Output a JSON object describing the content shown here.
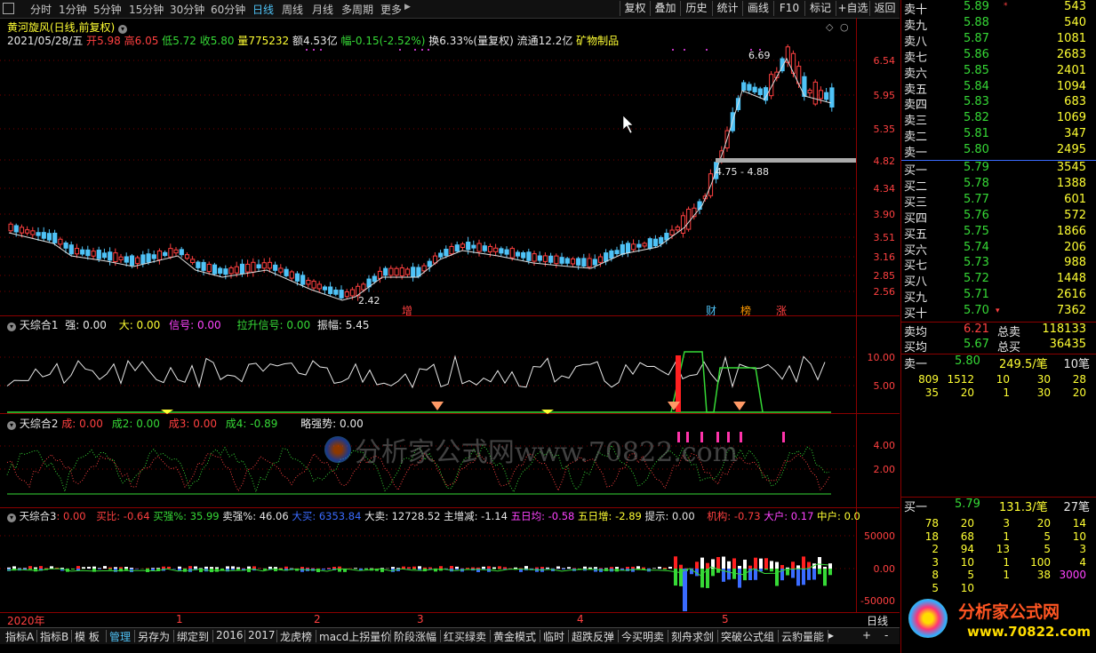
{
  "toolbar": {
    "timeframes": [
      "分时",
      "1分钟",
      "5分钟",
      "15分钟",
      "30分钟",
      "60分钟",
      "日线",
      "周线",
      "月线",
      "多周期",
      "更多"
    ],
    "active_timeframe": "日线",
    "right_buttons": [
      "复权",
      "叠加",
      "历史",
      "统计",
      "画线",
      "F10",
      "标记",
      "+自选",
      "返回"
    ]
  },
  "stock": {
    "name": "黄河旋风(日线,前复权)",
    "date": "2021/05/28/五",
    "open_label": "开",
    "open": "5.98",
    "high_label": "高",
    "high": "6.05",
    "low_label": "低",
    "low": "5.72",
    "close_label": "收",
    "close": "5.80",
    "vol_label": "量",
    "vol": "775232",
    "amount_label": "额",
    "amount": "4.53亿",
    "chg_label": "幅",
    "chg": "-0.15(-2.52%)",
    "turnover_label": "换",
    "turnover": "6.33%(量复权)",
    "float_label": "流通",
    "float_cap": "12.2亿",
    "industry": "矿物制品"
  },
  "main_chart": {
    "price_ticks": [
      "6.54",
      "5.95",
      "5.35",
      "4.82",
      "4.34",
      "3.90",
      "3.51",
      "3.16",
      "2.85",
      "2.56"
    ],
    "high_mark": "6.69",
    "low_mark": "2.42",
    "range_label": "4.75 - 4.88",
    "event_markers": [
      {
        "text": "增",
        "color": "#ff4040"
      },
      {
        "text": "财",
        "color": "#4fc3f7"
      },
      {
        "text": "榜",
        "color": "#ff9900"
      },
      {
        "text": "涨",
        "color": "#ff4040"
      }
    ]
  },
  "ind1": {
    "name": "天综合1",
    "items": [
      {
        "label": "强: 0.00",
        "color": "#e8e8e8"
      },
      {
        "label": "大: 0.00",
        "color": "#ffff33"
      },
      {
        "label": "信号: 0.00",
        "color": "#ff44ff"
      },
      {
        "label": "拉升信号: 0.00",
        "color": "#36d936"
      },
      {
        "label": "振幅: 5.45",
        "color": "#e8e8e8"
      }
    ],
    "ticks": [
      "10.00",
      "5.00"
    ]
  },
  "ind2": {
    "name": "天综合2",
    "items": [
      {
        "label": "成: 0.00",
        "color": "#ff4040"
      },
      {
        "label": "成2: 0.00",
        "color": "#36d936"
      },
      {
        "label": "成3: 0.00",
        "color": "#ff4040"
      },
      {
        "label": "成4: -0.89",
        "color": "#36d936"
      },
      {
        "label": "略强势: 0.00",
        "color": "#e8e8e8"
      }
    ],
    "ticks": [
      "4.00",
      "2.00"
    ]
  },
  "ind3": {
    "name": "天综合3",
    "items": [
      {
        "label": ": 0.00",
        "color": "#ff4040"
      },
      {
        "label": "买比: -0.64",
        "color": "#ff4040"
      },
      {
        "label": "买强%: 35.99",
        "color": "#36d936"
      },
      {
        "label": "卖强%: 46.06",
        "color": "#e8e8e8"
      },
      {
        "label": "大买: 6353.84",
        "color": "#3a6bff"
      },
      {
        "label": "大卖: 12728.52",
        "color": "#e8e8e8"
      },
      {
        "label": "主增减: -1.14",
        "color": "#e8e8e8"
      },
      {
        "label": "五日均: -0.58",
        "color": "#ff44ff"
      },
      {
        "label": "五日增: -2.89",
        "color": "#ffff33"
      },
      {
        "label": "提示: 0.00",
        "color": "#e8e8e8"
      },
      {
        "label": "机构: -0.73",
        "color": "#ff4040"
      },
      {
        "label": "大户: 0.17",
        "color": "#ff44ff"
      },
      {
        "label": "中户: 0.0",
        "color": "#ffff33"
      }
    ],
    "ticks": [
      "50000",
      "0.00",
      "-50000"
    ]
  },
  "x_axis": {
    "labels": [
      "2020年",
      "1",
      "2",
      "3",
      "4",
      "5"
    ],
    "period": "日线"
  },
  "watermark": {
    "text": "分析家公式网www.70822.com",
    "logo": "分析家公式网",
    "url": "www.70822.com"
  },
  "order_book": {
    "asks": [
      {
        "label": "卖十",
        "price": "5.89",
        "vol": "543"
      },
      {
        "label": "卖九",
        "price": "5.88",
        "vol": "540"
      },
      {
        "label": "卖八",
        "price": "5.87",
        "vol": "1081"
      },
      {
        "label": "卖七",
        "price": "5.86",
        "vol": "2683"
      },
      {
        "label": "卖六",
        "price": "5.85",
        "vol": "2401"
      },
      {
        "label": "卖五",
        "price": "5.84",
        "vol": "1094"
      },
      {
        "label": "卖四",
        "price": "5.83",
        "vol": "683"
      },
      {
        "label": "卖三",
        "price": "5.82",
        "vol": "1069"
      },
      {
        "label": "卖二",
        "price": "5.81",
        "vol": "347"
      },
      {
        "label": "卖一",
        "price": "5.80",
        "vol": "2495"
      }
    ],
    "bids": [
      {
        "label": "买一",
        "price": "5.79",
        "vol": "3545"
      },
      {
        "label": "买二",
        "price": "5.78",
        "vol": "1388"
      },
      {
        "label": "买三",
        "price": "5.77",
        "vol": "601"
      },
      {
        "label": "买四",
        "price": "5.76",
        "vol": "572"
      },
      {
        "label": "买五",
        "price": "5.75",
        "vol": "1866"
      },
      {
        "label": "买六",
        "price": "5.74",
        "vol": "206"
      },
      {
        "label": "买七",
        "price": "5.73",
        "vol": "988"
      },
      {
        "label": "买八",
        "price": "5.72",
        "vol": "1448"
      },
      {
        "label": "买九",
        "price": "5.71",
        "vol": "2616"
      },
      {
        "label": "买十",
        "price": "5.70",
        "vol": "7362"
      }
    ],
    "ask_avg_label": "卖均",
    "ask_avg": "6.21",
    "total_sell_label": "总卖",
    "total_sell": "118133",
    "bid_avg_label": "买均",
    "bid_avg": "5.67",
    "total_buy_label": "总买",
    "total_buy": "36435",
    "sell1": {
      "label": "卖一",
      "price": "5.80",
      "lots": "249.5/笔",
      "count": "10笔"
    },
    "sell1_queue": [
      [
        "809",
        "1512",
        "10",
        "30",
        "28"
      ],
      [
        "35",
        "20",
        "1",
        "30",
        "20"
      ]
    ],
    "buy1": {
      "label": "买一",
      "price": "5.79",
      "lots": "131.3/笔",
      "count": "27笔"
    },
    "buy1_queue": [
      [
        "78",
        "20",
        "3",
        "20",
        "14"
      ],
      [
        "18",
        "68",
        "1",
        "5",
        "10"
      ],
      [
        "2",
        "94",
        "13",
        "5",
        "3"
      ],
      [
        "3",
        "10",
        "1",
        "100",
        "4"
      ],
      [
        "8",
        "5",
        "1",
        "38",
        "3000"
      ],
      [
        "5",
        "10",
        "",
        "",
        ""
      ]
    ]
  },
  "tabs": [
    "指标A",
    "指标B",
    "模 板",
    "管理",
    "另存为",
    "绑定到",
    "2016",
    "2017",
    "龙虎榜",
    "macd上拐量价",
    "阶段涨幅",
    "红买绿卖",
    "黄金模式",
    "临时",
    "超跌反弹",
    "今买明卖",
    "刻舟求剑",
    "突破公式组",
    "云豹量能"
  ],
  "active_tab": "管理",
  "tab_controls": [
    "+",
    "-"
  ],
  "colors": {
    "up": "#ff4040",
    "down": "#4fc3f7",
    "border": "#8b0000"
  }
}
